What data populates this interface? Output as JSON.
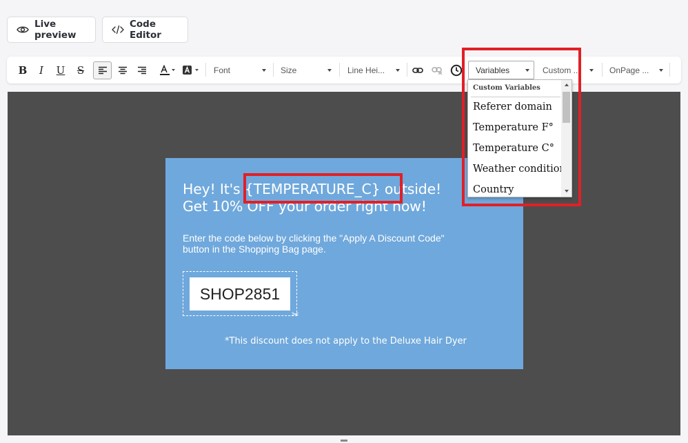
{
  "top_bar": {
    "live_preview_label": "Live preview",
    "code_editor_label": "Code Editor"
  },
  "toolbar": {
    "bold_label": "B",
    "italic_label": "I",
    "underline_label": "U",
    "strike_label": "S",
    "font_label": "Font",
    "size_label": "Size",
    "line_height_label": "Line Hei...",
    "variables_label": "Variables",
    "custom_label": "Custom ...",
    "onpage_label": "OnPage ..."
  },
  "popup": {
    "headline_pre": "Hey! It's ",
    "headline_var": "{TEMPERATURE_C}",
    "headline_post": " outside!",
    "headline_line2": "Get 10% OFF your order right now!",
    "body": "Enter the code below by clicking the \"Apply A Discount Code\" button in the Shopping Bag page.",
    "coupon_code": "SHOP2851",
    "disclaimer": "*This discount does not apply to the Deluxe Hair Dyer"
  },
  "variables_dropdown": {
    "group_header": "Custom Variables",
    "options": [
      "Referer domain",
      "Temperature F°",
      "Temperature C°",
      "Weather condition",
      "Country"
    ]
  },
  "colors": {
    "highlight": "#e21f26",
    "canvas_bg": "#4d4d4d",
    "popup_bg": "#6fa8dc"
  }
}
